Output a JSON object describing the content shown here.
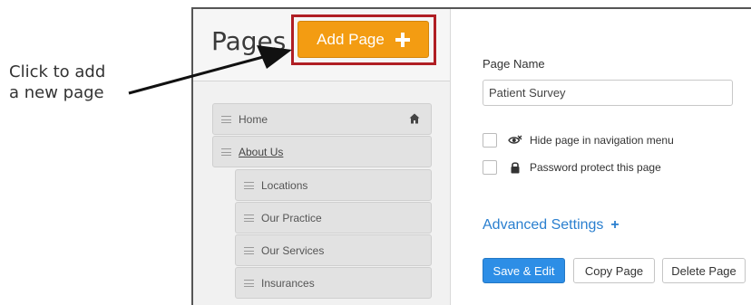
{
  "annotation": {
    "line1": "Click to add",
    "line2": "a new page"
  },
  "left_panel": {
    "title": "Pages",
    "add_button_label": "Add Page",
    "add_button_icon": "plus-icon",
    "nav_items": [
      {
        "label": "Home",
        "level": 0,
        "is_home": true
      },
      {
        "label": "About Us",
        "level": 0,
        "underlined": true
      },
      {
        "label": "Locations",
        "level": 1
      },
      {
        "label": "Our Practice",
        "level": 1
      },
      {
        "label": "Our Services",
        "level": 1
      },
      {
        "label": "Insurances",
        "level": 1
      }
    ]
  },
  "right_panel": {
    "page_name_label": "Page Name",
    "page_name_value": "Patient Survey",
    "hide_nav_label": "Hide page in navigation menu",
    "hide_nav_icon": "eye-slash-icon",
    "password_label": "Password protect this page",
    "password_icon": "lock-icon",
    "advanced_settings_label": "Advanced Settings",
    "advanced_settings_icon": "+",
    "buttons": {
      "save_edit": "Save & Edit",
      "copy_page": "Copy Page",
      "delete_page": "Delete Page"
    }
  },
  "colors": {
    "add_button": "#f39c12",
    "highlight_border": "#b01e24",
    "primary_button": "#2d8ee6",
    "link": "#2a7fcf"
  }
}
